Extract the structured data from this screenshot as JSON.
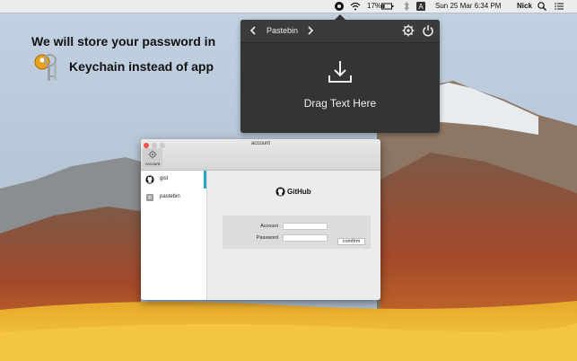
{
  "menubar": {
    "battery_percent": "17%",
    "date_time": "Sun 25 Mar  6:34 PM",
    "user_name": "Nick",
    "icons": [
      "gist-app-icon",
      "wifi-icon",
      "battery-icon",
      "bluetooth-icon",
      "input-source-icon",
      "search-icon",
      "list-icon"
    ]
  },
  "headline": {
    "line1": "We will store your password in",
    "line2": "Keychain instead of app",
    "icon": "keychain-icon"
  },
  "popover": {
    "title": "Pastebin",
    "drag_label": "Drag Text Here",
    "icons": [
      "chevron-left-icon",
      "chevron-right-icon",
      "gear-icon",
      "power-icon",
      "download-icon"
    ]
  },
  "window": {
    "title": "account",
    "toolbar_label": "Account",
    "sidebar": [
      {
        "label": "gist",
        "icon": "github-icon",
        "selected": true
      },
      {
        "label": "pastebin",
        "icon": "pastebin-icon",
        "selected": false
      }
    ],
    "service_name": "GitHub",
    "form": {
      "account_label": "Account",
      "password_label": "Password",
      "account_value": "",
      "password_value": "",
      "confirm_label": "comfirm"
    }
  },
  "colors": {
    "accent": "#2aa6c6",
    "popover_bg": "#343434"
  }
}
